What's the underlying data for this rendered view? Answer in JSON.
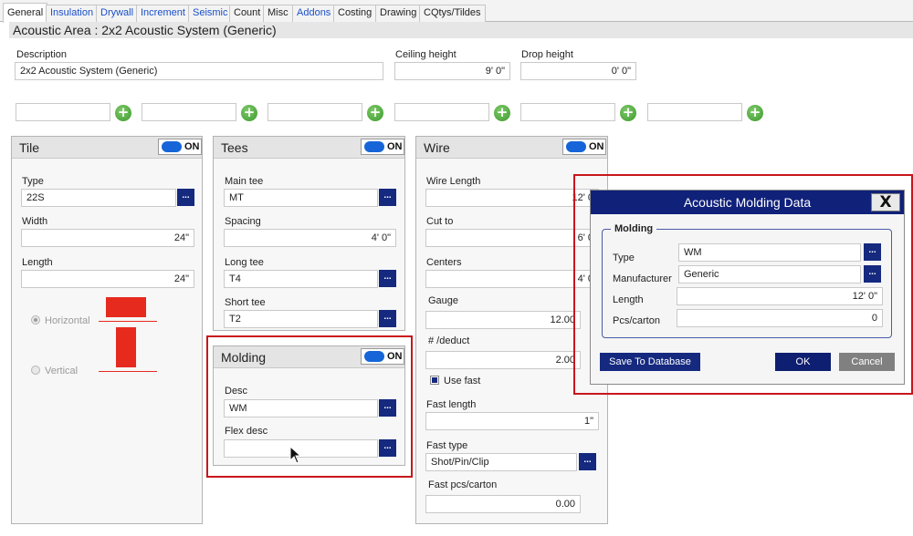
{
  "tabs": [
    "General",
    "Insulation",
    "Drywall",
    "Increment",
    "Seismic",
    "Count",
    "Misc",
    "Addons",
    "Costing",
    "Drawing",
    "CQtys/Tildes"
  ],
  "header": {
    "title": "Acoustic Area : 2x2 Acoustic System (Generic)"
  },
  "top": {
    "description_label": "Description",
    "description_value": "2x2 Acoustic System (Generic)",
    "ceiling_label": "Ceiling height",
    "ceiling_value": "9' 0\"",
    "drop_label": "Drop height",
    "drop_value": "0' 0\""
  },
  "tile": {
    "title": "Tile",
    "toggle": "ON",
    "type_label": "Type",
    "type_value": "22S",
    "width_label": "Width",
    "width_value": "24\"",
    "length_label": "Length",
    "length_value": "24\"",
    "horizontal_label": "Horizontal",
    "vertical_label": "Vertical",
    "horizontal_selected": true
  },
  "tees": {
    "title": "Tees",
    "toggle": "ON",
    "main_label": "Main tee",
    "main_value": "MT",
    "spacing_label": "Spacing",
    "spacing_value": "4' 0\"",
    "long_label": "Long tee",
    "long_value": "T4",
    "short_label": "Short tee",
    "short_value": "T2"
  },
  "molding": {
    "title": "Molding",
    "toggle": "ON",
    "desc_label": "Desc",
    "desc_value": "WM",
    "flex_label": "Flex desc",
    "flex_value": ""
  },
  "wire": {
    "title": "Wire",
    "toggle": "ON",
    "length_label": "Wire Length",
    "length_value": "12' 0",
    "cut_label": "Cut to",
    "cut_value": "6' 0",
    "centers_label": "Centers",
    "centers_value": "4' 0",
    "gauge_label": "Gauge",
    "gauge_value": "12.00",
    "deduct_label": "# /deduct",
    "deduct_value": "2.00",
    "usefast_label": "Use fast",
    "usefast_checked": true,
    "fastlength_label": "Fast length",
    "fastlength_value": "1\"",
    "fasttype_label": "Fast type",
    "fasttype_value": "Shot/Pin/Clip",
    "fastpcs_label": "Fast pcs/carton",
    "fastpcs_value": "0.00"
  },
  "dialog": {
    "title": "Acoustic Molding Data",
    "close": "X",
    "group": "Molding",
    "type_label": "Type",
    "type_value": "WM",
    "mfr_label": "Manufacturer",
    "mfr_value": "Generic",
    "length_label": "Length",
    "length_value": "12' 0\"",
    "pcs_label": "Pcs/carton",
    "pcs_value": "0",
    "save_btn": "Save To Database",
    "ok_btn": "OK",
    "cancel_btn": "Cancel"
  },
  "icons": {
    "plus": "+",
    "more": "..."
  },
  "colors": {
    "accent": "#15297f",
    "highlight": "#c8161d",
    "toggle": "#1565d8",
    "add": "#3d9a2d"
  }
}
